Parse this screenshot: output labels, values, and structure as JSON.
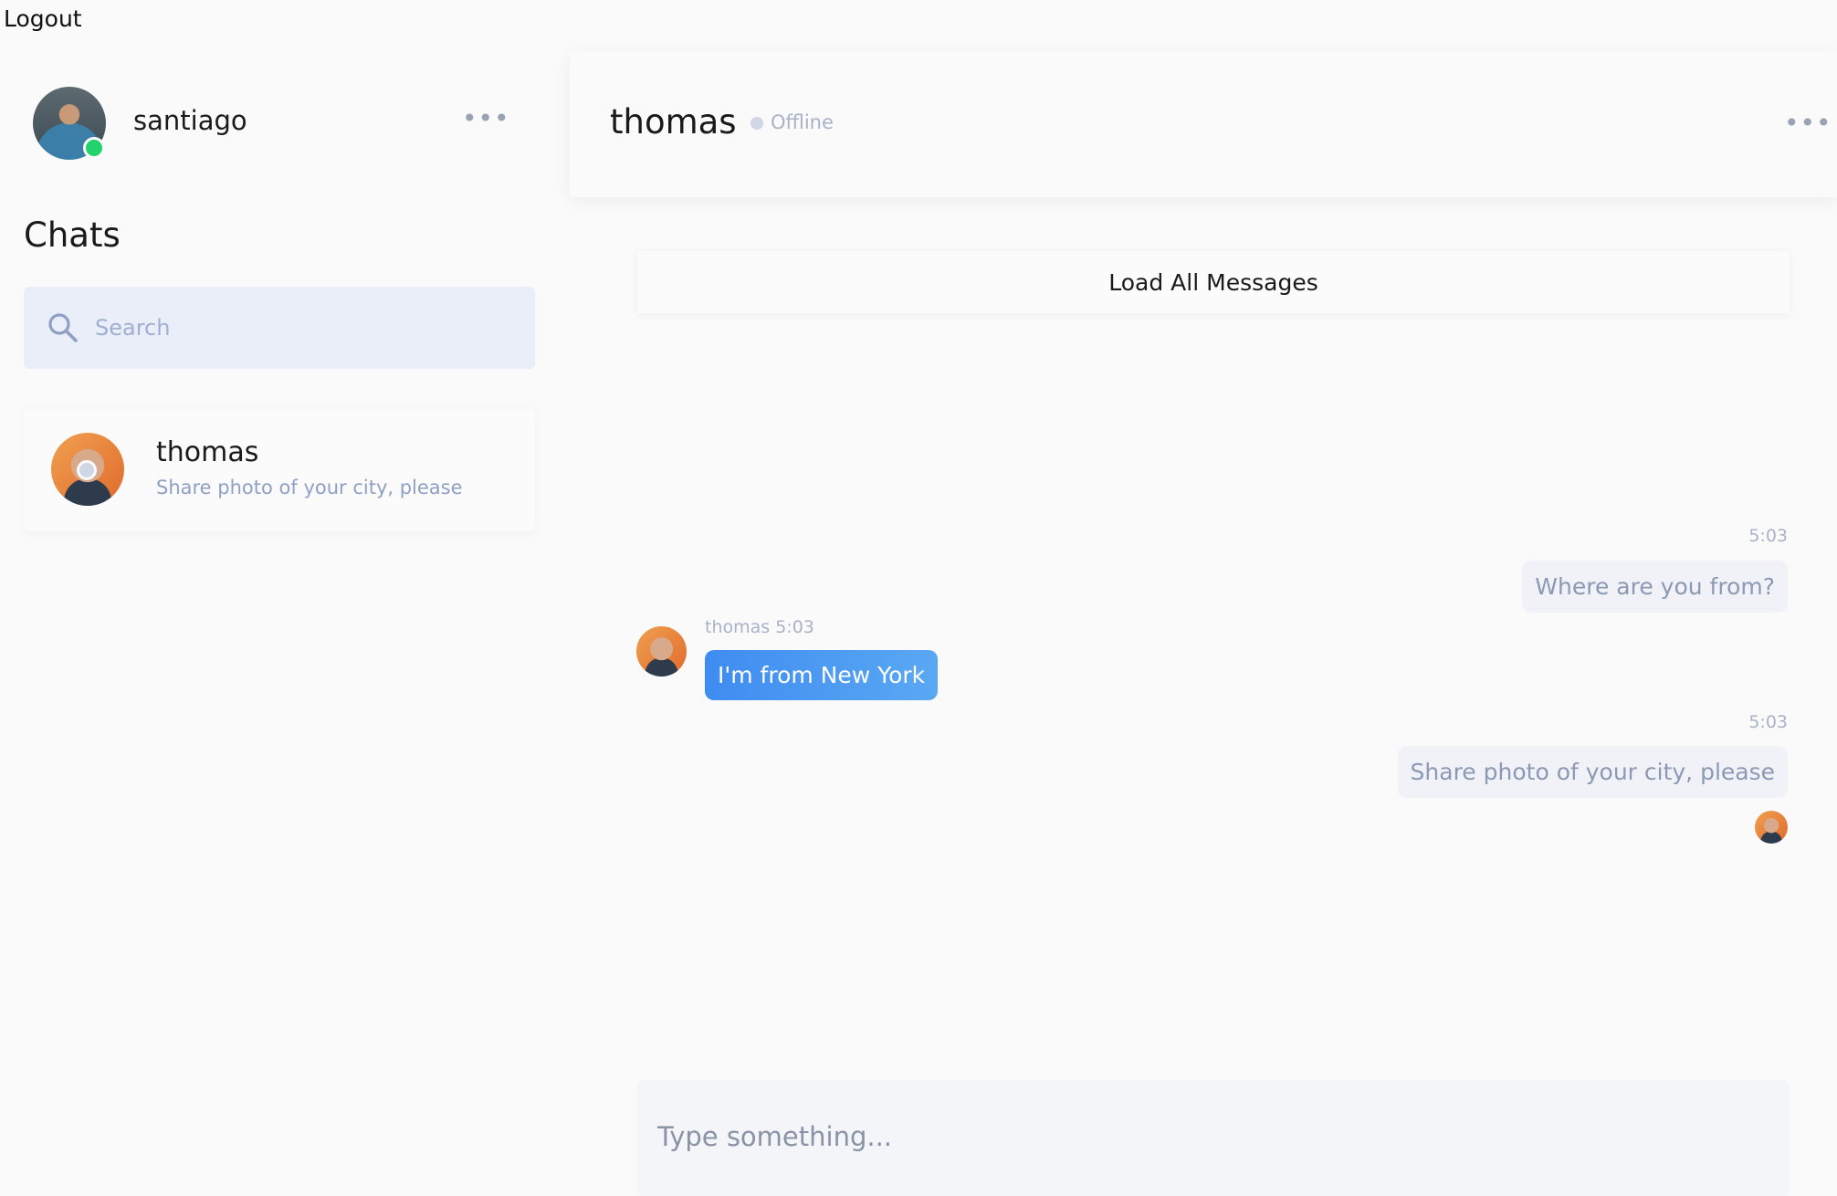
{
  "app": {
    "logout_label": "Logout"
  },
  "current_user": {
    "name": "santiago",
    "status": "online",
    "menu_icon": "more-horizontal-icon"
  },
  "sidebar": {
    "title": "Chats",
    "search": {
      "placeholder": "Search",
      "value": "",
      "icon": "search-icon"
    },
    "chats": [
      {
        "name": "thomas",
        "preview": "Share photo of your city, please",
        "status": "offline"
      }
    ]
  },
  "conversation": {
    "contact_name": "thomas",
    "contact_status": "Offline",
    "menu_icon": "more-horizontal-icon",
    "load_all_label": "Load All Messages",
    "messages": [
      {
        "direction": "outgoing",
        "time": "5:03",
        "text": "Where are you from?"
      },
      {
        "direction": "incoming",
        "sender": "thomas",
        "time": "5:03",
        "meta": "thomas 5:03",
        "text": "I'm from New York"
      },
      {
        "direction": "outgoing",
        "time": "5:03",
        "text": "Share photo of your city, please"
      }
    ],
    "composer": {
      "placeholder": "Type something...",
      "value": ""
    }
  },
  "colors": {
    "online": "#22d36b",
    "offline": "#cfd7e6",
    "incoming_bubble_start": "#3f8cf1",
    "incoming_bubble_end": "#5aa8f3",
    "outgoing_bubble": "#f0f2f7",
    "search_bg": "#e9eef9"
  }
}
